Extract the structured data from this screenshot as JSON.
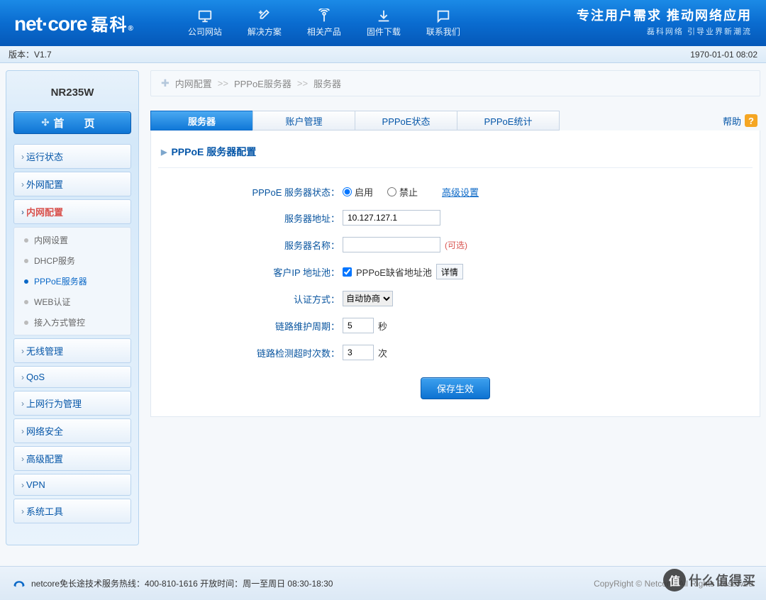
{
  "header": {
    "brand_en": "net·core",
    "brand_cn": "磊科",
    "slogan1": "专注用户需求  推动网络应用",
    "slogan2": "磊科网络 引导业界新潮流",
    "nav": [
      {
        "label": "公司网站"
      },
      {
        "label": "解决方案"
      },
      {
        "label": "相关产品"
      },
      {
        "label": "固件下载"
      },
      {
        "label": "联系我们"
      }
    ]
  },
  "subbar": {
    "version": "版本：V1.7",
    "time": "1970-01-01 08:02"
  },
  "sidebar": {
    "model": "NR235W",
    "home": "首 页",
    "items": [
      {
        "label": "运行状态"
      },
      {
        "label": "外网配置"
      },
      {
        "label": "内网配置",
        "active": true,
        "children": [
          {
            "label": "内网设置"
          },
          {
            "label": "DHCP服务"
          },
          {
            "label": "PPPoE服务器",
            "active": true
          },
          {
            "label": "WEB认证"
          },
          {
            "label": "接入方式管控"
          }
        ]
      },
      {
        "label": "无线管理"
      },
      {
        "label": "QoS"
      },
      {
        "label": "上网行为管理"
      },
      {
        "label": "网络安全"
      },
      {
        "label": "高级配置"
      },
      {
        "label": "VPN"
      },
      {
        "label": "系统工具"
      }
    ]
  },
  "breadcrumb": {
    "a": "内网配置",
    "b": "PPPoE服务器",
    "c": "服务器",
    "sep": ">>"
  },
  "tabs": [
    {
      "label": "服务器",
      "active": true
    },
    {
      "label": "账户管理"
    },
    {
      "label": "PPPoE状态"
    },
    {
      "label": "PPPoE统计"
    }
  ],
  "help": "帮助",
  "panel": {
    "title": "PPPoE 服务器配置",
    "status_label": "PPPoE 服务器状态：",
    "status_enable": "启用",
    "status_disable": "禁止",
    "adv_link": "高级设置",
    "addr_label": "服务器地址：",
    "addr_value": "10.127.127.1",
    "name_label": "服务器名称：",
    "name_value": "",
    "name_optional": "(可选)",
    "pool_label": "客户IP 地址池：",
    "pool_name": "PPPoE缺省地址池",
    "pool_detail": "详情",
    "auth_label": "认证方式：",
    "auth_value": "自动协商",
    "keepalive_label": "链路维护周期：",
    "keepalive_value": "5",
    "keepalive_unit": "秒",
    "timeout_label": "链路检测超时次数：",
    "timeout_value": "3",
    "timeout_unit": "次",
    "save": "保存生效"
  },
  "footer": {
    "hotline": "netcore免长途技术服务热线：400-810-1616  开放时间：周一至周日 08:30-18:30",
    "copy": "CopyRight © Netcore. All Rights Reserved"
  },
  "watermark": {
    "txt": "什么值得买"
  }
}
